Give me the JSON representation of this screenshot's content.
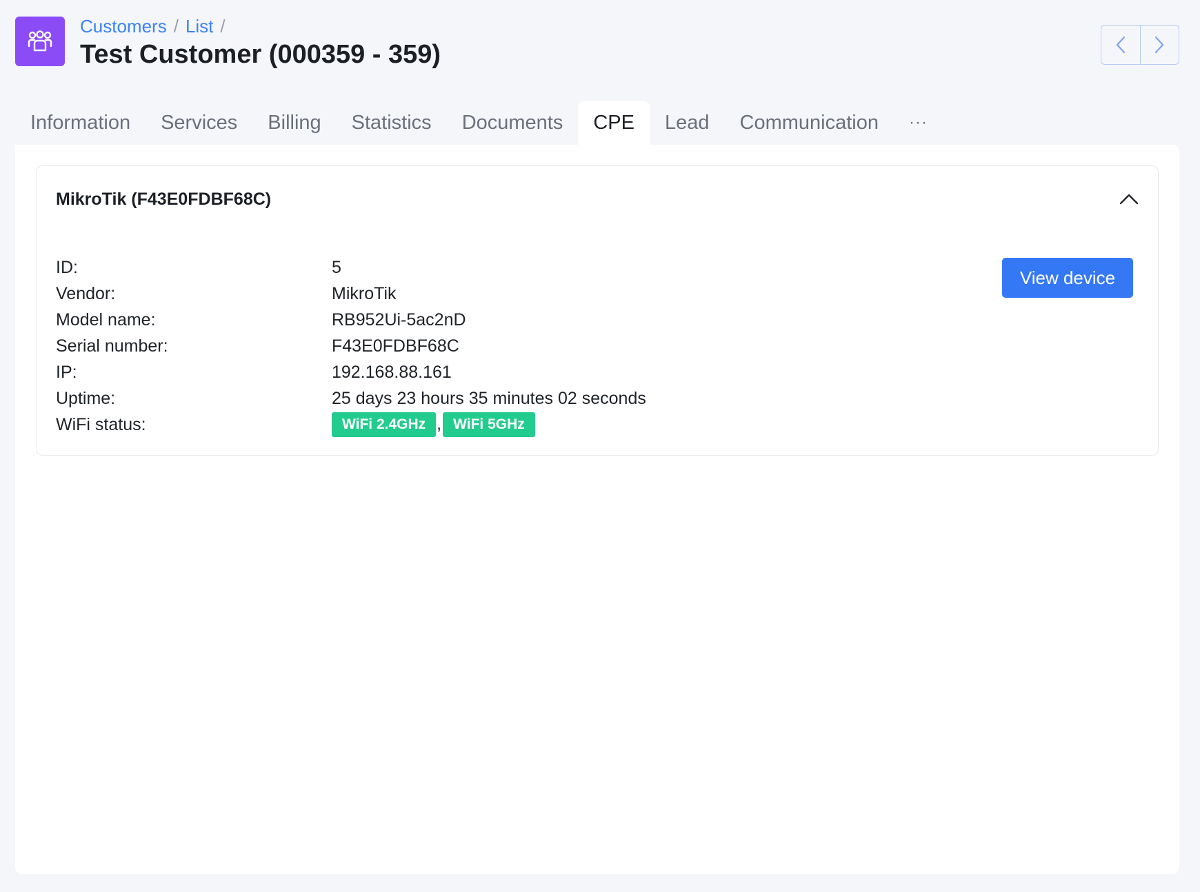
{
  "breadcrumb": {
    "items": [
      "Customers",
      "List"
    ],
    "separator": "/"
  },
  "page_title": "Test Customer (000359 - 359)",
  "app_icon": "customers-group-icon",
  "pager": {
    "prev_icon": "chevron-left-icon",
    "next_icon": "chevron-right-icon"
  },
  "tabs": [
    {
      "label": "Information",
      "active": false
    },
    {
      "label": "Services",
      "active": false
    },
    {
      "label": "Billing",
      "active": false
    },
    {
      "label": "Statistics",
      "active": false
    },
    {
      "label": "Documents",
      "active": false
    },
    {
      "label": "CPE",
      "active": true
    },
    {
      "label": "Lead",
      "active": false
    },
    {
      "label": "Communication",
      "active": false
    },
    {
      "label": "···",
      "active": false
    }
  ],
  "device": {
    "title": "MikroTik (F43E0FDBF68C)",
    "view_button": "View device",
    "fields": [
      {
        "label": "ID:",
        "value": "5"
      },
      {
        "label": "Vendor:",
        "value": "MikroTik"
      },
      {
        "label": "Model name:",
        "value": "RB952Ui-5ac2nD"
      },
      {
        "label": "Serial number:",
        "value": "F43E0FDBF68C"
      },
      {
        "label": "IP:",
        "value": "192.168.88.161"
      },
      {
        "label": "Uptime:",
        "value": "25 days 23 hours 35 minutes 02 seconds"
      }
    ],
    "wifi_label": "WiFi status:",
    "wifi_badges": [
      "WiFi 2.4GHz",
      "WiFi 5GHz"
    ],
    "wifi_separator": ",",
    "badge_color": "#22cc8f"
  },
  "colors": {
    "accent": "#3478f6",
    "app_icon_bg": "#8b4cf7",
    "link": "#3b82f6"
  }
}
